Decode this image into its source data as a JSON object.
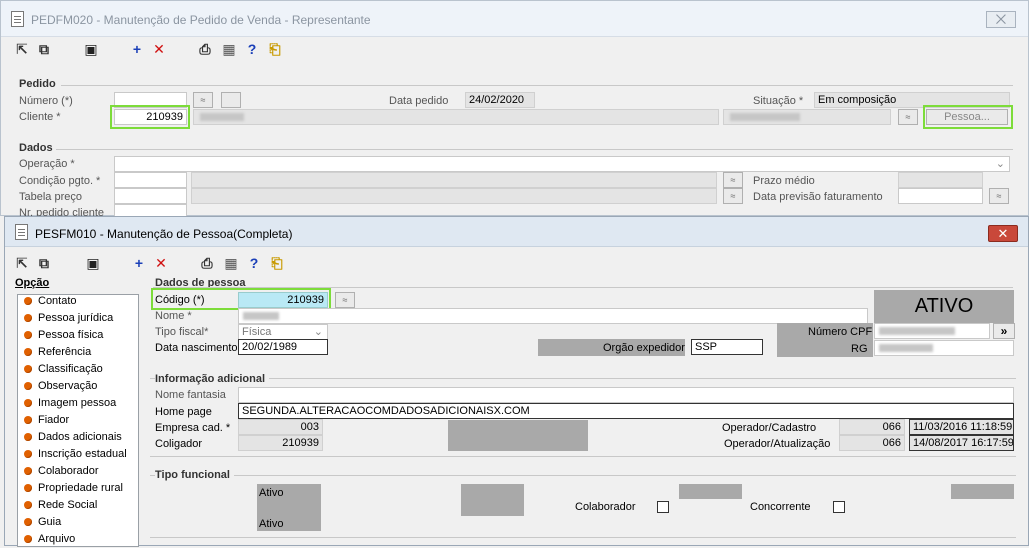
{
  "back": {
    "title": "PEDFM020 - Manutenção de Pedido de Venda - Representante",
    "close": "⨉",
    "sec_pedido": "Pedido",
    "lbl_numero": "Número (*)",
    "lbl_cliente": "Cliente *",
    "cliente_value": "210939",
    "lbl_data_pedido": "Data pedido",
    "data_pedido": "24/02/2020",
    "lbl_situacao": "Situação *",
    "situacao": "Em composição",
    "pessoa_btn": "Pessoa...",
    "sec_dados": "Dados",
    "lbl_operacao": "Operação *",
    "lbl_cond": "Condição pgto. *",
    "lbl_tabela": "Tabela preço",
    "lbl_nr_cliente": "Nr. pedido cliente",
    "lbl_prazo": "Prazo médio",
    "lbl_previsao": "Data previsão faturamento"
  },
  "front": {
    "title": "PESFM010 - Manutenção de Pessoa(Completa)",
    "close": "✕",
    "opcao_header": "Opção",
    "opcoes": [
      "Contato",
      "Pessoa jurídica",
      "Pessoa física",
      "Referência",
      "Classificação",
      "Observação",
      "Imagem pessoa",
      "Fiador",
      "Dados adicionais",
      "Inscrição estadual",
      "Colaborador",
      "Propriedade rural",
      "Rede Social",
      "Guia",
      "Arquivo"
    ],
    "sec_dados_pessoa": "Dados de pessoa",
    "lbl_codigo": "Código (*)",
    "codigo": "210939",
    "lbl_nome": "Nome *",
    "lbl_tipo_fiscal": "Tipo fiscal*",
    "tipo_fiscal": "Física",
    "lbl_nasc": "Data nascimento",
    "nasc": "20/02/1989",
    "lbl_orgao": "Orgão expedidor",
    "orgao": "SSP",
    "status": "ATIVO",
    "lbl_cpf": "Número CPF",
    "lbl_rg": "RG",
    "cpf_btn": "»",
    "sec_info": "Informação adicional",
    "lbl_fantasia": "Nome fantasia",
    "lbl_home": "Home page",
    "home": "SEGUNDA.ALTERACAOCOMDADOSADICIONAISX.COM",
    "lbl_empresa": "Empresa cad. *",
    "empresa": "003",
    "lbl_coligador": "Coligador",
    "coligador": "210939",
    "lbl_op_cad": "Operador/Cadastro",
    "op_cad": "066",
    "op_cad_dt": "11/03/2016 11:18:59",
    "lbl_op_at": "Operador/Atualização",
    "op_at": "066",
    "op_at_dt": "14/08/2017 16:17:59",
    "sec_tipo_func": "Tipo funcional",
    "ativo1": "Ativo",
    "ativo2": "Ativo",
    "lbl_colab": "Colaborador",
    "lbl_conc": "Concorrente"
  }
}
